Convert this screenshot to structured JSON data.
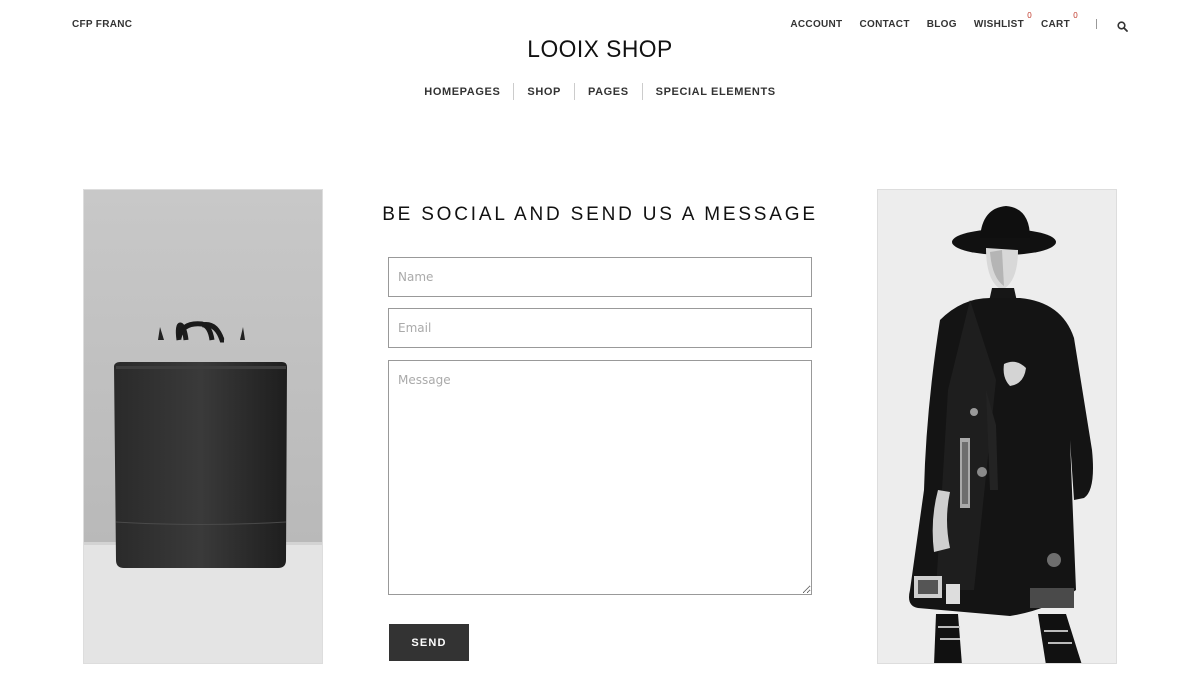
{
  "header": {
    "currency": "CFP FRANC",
    "logo": "LOOIX SHOP",
    "top_links": [
      {
        "label": "ACCOUNT"
      },
      {
        "label": "CONTACT"
      },
      {
        "label": "BLOG"
      },
      {
        "label": "WISHLIST",
        "count": "0"
      },
      {
        "label": "CART",
        "count": "0"
      }
    ],
    "search_icon": "search-icon"
  },
  "main_nav": {
    "items": [
      {
        "label": "HOMEPAGES"
      },
      {
        "label": "SHOP"
      },
      {
        "label": "PAGES"
      },
      {
        "label": "SPECIAL ELEMENTS"
      }
    ]
  },
  "contact": {
    "title": "BE SOCIAL AND SEND US A MESSAGE",
    "name_placeholder": "Name",
    "email_placeholder": "Email",
    "message_placeholder": "Message",
    "send_label": "SEND"
  },
  "images": {
    "left": "black-backpack-photo",
    "right": "man-in-hat-and-coat-photo"
  },
  "colors": {
    "accent": "#333333",
    "badge": "#c0392b",
    "border": "#999999"
  }
}
